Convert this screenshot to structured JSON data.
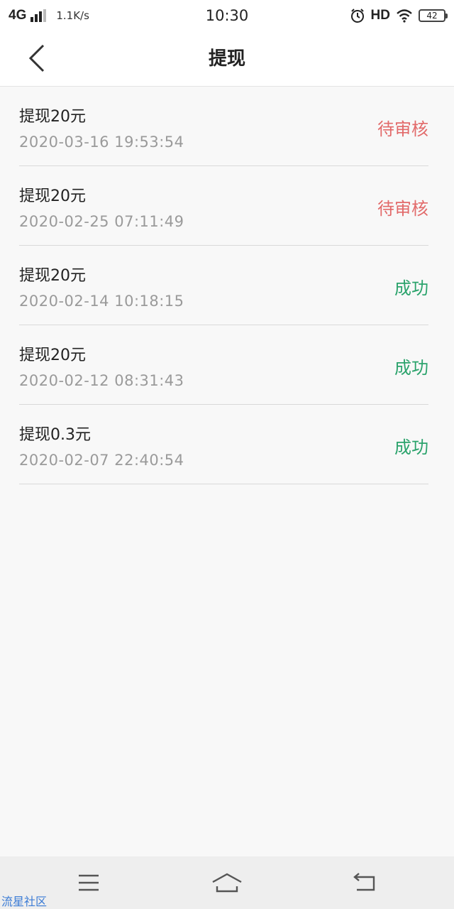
{
  "status_bar": {
    "network": "4G",
    "speed": "1.1K/s",
    "time": "10:30",
    "hd": "HD",
    "battery": "42"
  },
  "header": {
    "title": "提现",
    "back_icon": "chevron-left-icon"
  },
  "records": [
    {
      "title": "提现20元",
      "time": "2020-03-16 19:53:54",
      "status": "待审核",
      "status_color": "#e26a6a"
    },
    {
      "title": "提现20元",
      "time": "2020-02-25 07:11:49",
      "status": "待审核",
      "status_color": "#e26a6a"
    },
    {
      "title": "提现20元",
      "time": "2020-02-14 10:18:15",
      "status": "成功",
      "status_color": "#2ba36c"
    },
    {
      "title": "提现20元",
      "time": "2020-02-12 08:31:43",
      "status": "成功",
      "status_color": "#2ba36c"
    },
    {
      "title": "提现0.3元",
      "time": "2020-02-07 22:40:54",
      "status": "成功",
      "status_color": "#2ba36c"
    }
  ],
  "bottom_nav": {
    "menu_icon": "menu-icon",
    "home_icon": "home-icon",
    "back_icon": "return-icon"
  },
  "watermark": "流星社区"
}
